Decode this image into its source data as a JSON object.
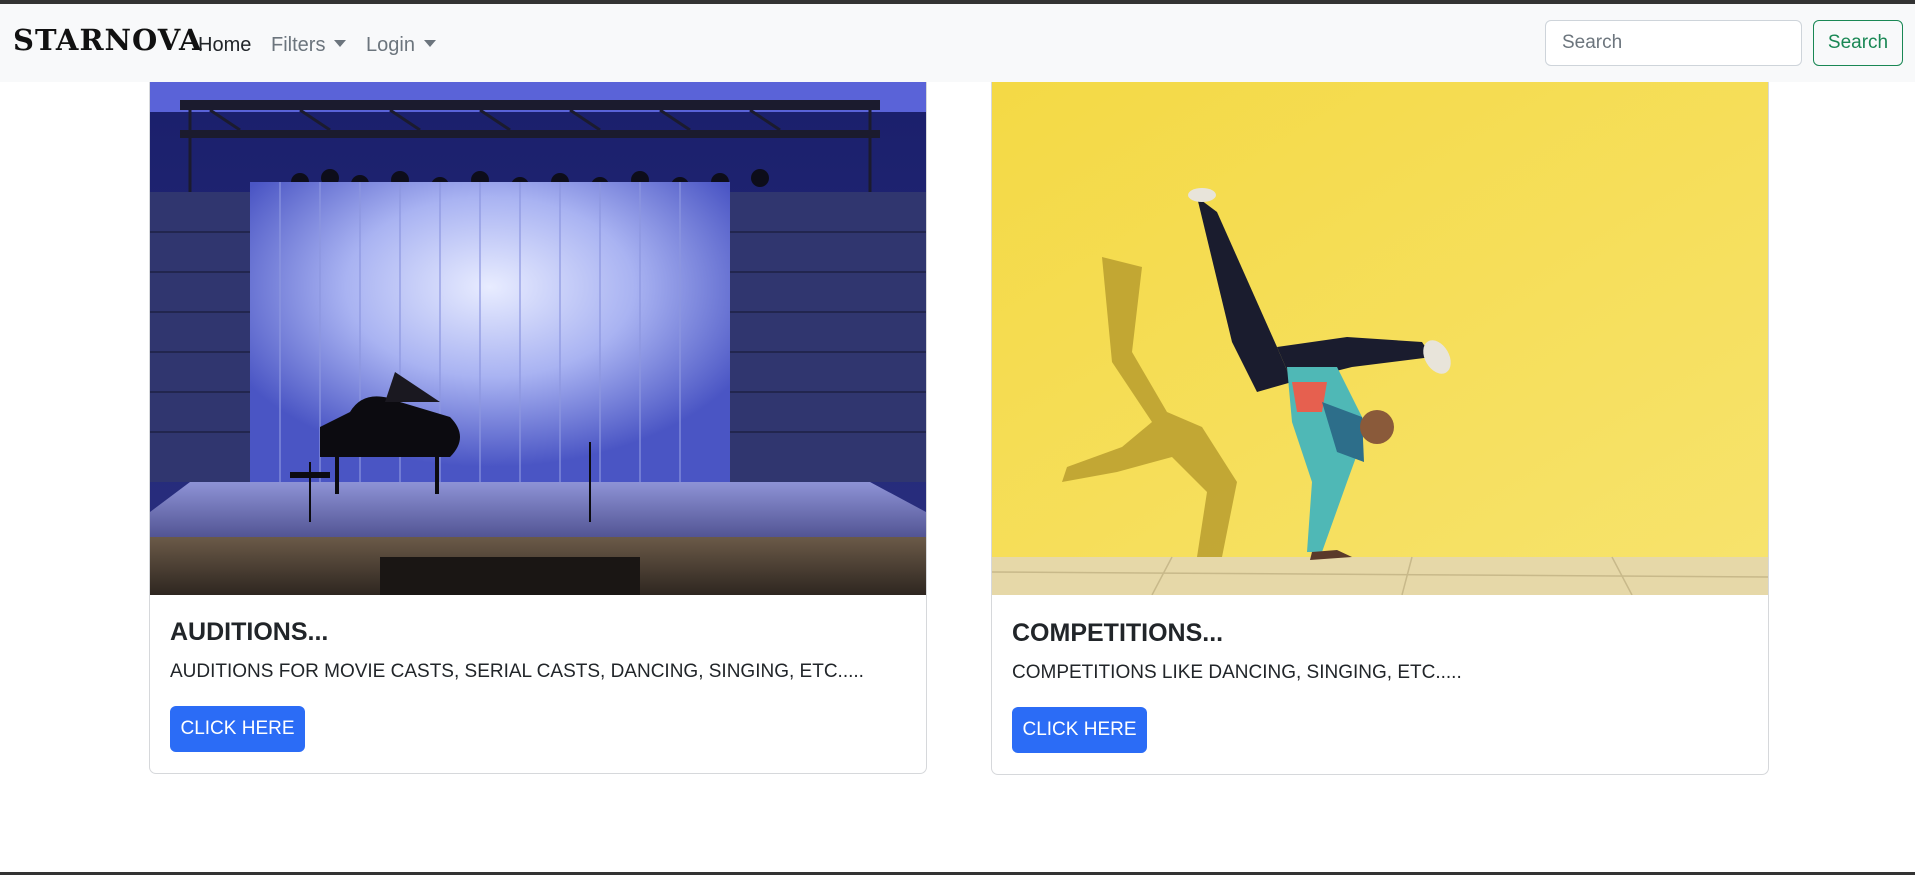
{
  "navbar": {
    "brand": "STARNOVA",
    "links": [
      {
        "label": "Home"
      },
      {
        "label": "Filters"
      },
      {
        "label": "Login"
      }
    ],
    "search": {
      "placeholder": "Search",
      "value": "",
      "button_label": "Search"
    }
  },
  "cards": [
    {
      "image": "theater-stage-with-grand-piano",
      "title": "AUDITIONS...",
      "text": "AUDITIONS FOR MOVIE CASTS, SERIAL CASTS, DANCING, SINGING, ETC.....",
      "button_label": "CLICK HERE"
    },
    {
      "image": "breakdancer-against-yellow-wall",
      "title": "COMPETITIONS...",
      "text": "COMPETITIONS LIKE DANCING, SINGING, ETC.....",
      "button_label": "CLICK HERE"
    }
  ],
  "colors": {
    "navbar_bg": "#f8f9fa",
    "primary_button": "#2b6cf6",
    "success_outline": "#198754",
    "stage_blue": "#3b45b8",
    "wall_yellow": "#f5dc52"
  }
}
